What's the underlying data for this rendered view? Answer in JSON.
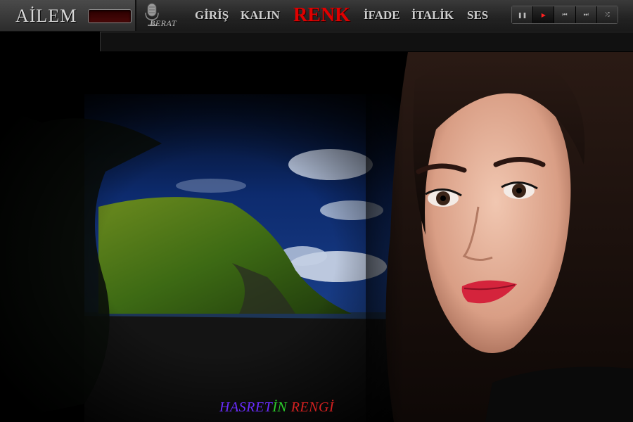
{
  "header": {
    "brand_title": "AİLEM",
    "mic_label": "BERAT",
    "nav": [
      {
        "label": "GİRİŞ"
      },
      {
        "label": "KALIN"
      },
      {
        "label": "RENK"
      },
      {
        "label": "İFADE"
      },
      {
        "label": "İTALİK"
      },
      {
        "label": "SES"
      }
    ]
  },
  "player": {
    "buttons": [
      {
        "icon": "pause-icon",
        "glyph": "❚❚"
      },
      {
        "icon": "play-icon",
        "glyph": "▶"
      },
      {
        "icon": "previous-icon",
        "glyph": "⏮"
      },
      {
        "icon": "next-icon",
        "glyph": "⏭"
      },
      {
        "icon": "shuffle-icon",
        "glyph": "⤮"
      }
    ],
    "active_index": 1
  },
  "caption": {
    "part1": "HASRET",
    "part2": "İN",
    "part3": " RENGİ"
  },
  "colors": {
    "accent": "#e00000",
    "caption_part1": "#6a2cff",
    "caption_part2": "#2bd02b",
    "caption_part3": "#d42020"
  }
}
